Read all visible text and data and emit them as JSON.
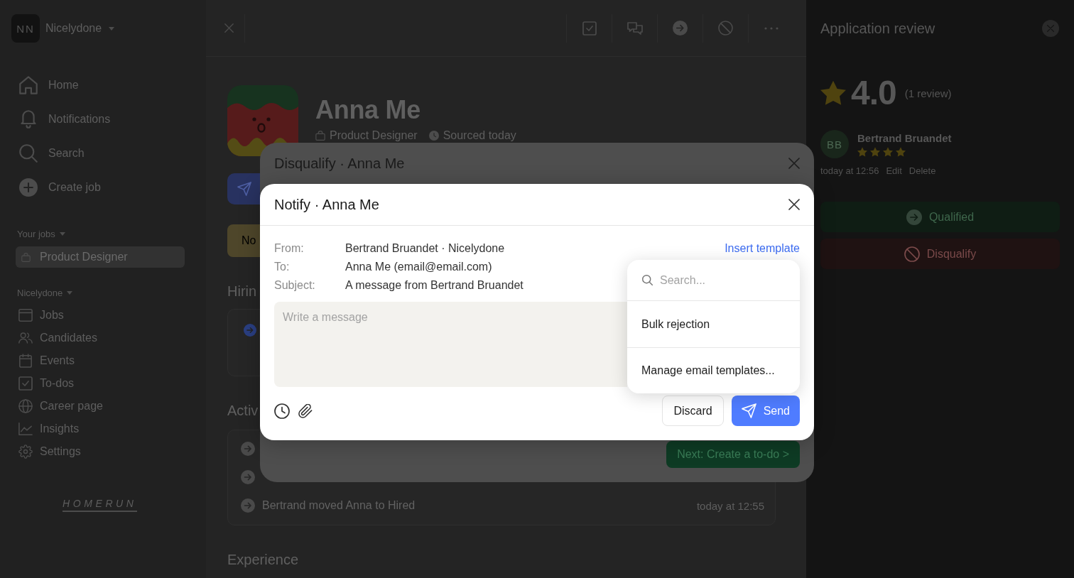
{
  "sidebar": {
    "workspace": {
      "initials": "NN",
      "name": "Nicelydone"
    },
    "nav": [
      {
        "label": "Home",
        "selected": false
      },
      {
        "label": "Notifications",
        "selected": false
      },
      {
        "label": "Search",
        "selected": false
      },
      {
        "label": "Create job",
        "selected": false
      }
    ],
    "your_jobs": {
      "heading": "Your jobs",
      "items": [
        {
          "label": "Product Designer",
          "selected": true
        }
      ]
    },
    "team": {
      "heading": "Nicelydone",
      "items": [
        {
          "label": "Jobs",
          "selected": false
        },
        {
          "label": "Candidates",
          "selected": false
        },
        {
          "label": "Events",
          "selected": false
        },
        {
          "label": "To-dos",
          "selected": false
        },
        {
          "label": "Career page",
          "selected": false
        },
        {
          "label": "Insights",
          "selected": false
        },
        {
          "label": "Settings",
          "selected": false
        }
      ]
    },
    "logo": "HOMERUN"
  },
  "profile": {
    "name": "Anna Me",
    "job": "Product Designer",
    "sourced": "Sourced today",
    "notice": "No",
    "hiring": {
      "heading": "Hirin"
    },
    "activity": {
      "heading": "Activ",
      "rows": [
        {
          "kind": "move"
        },
        {
          "kind": "move"
        },
        {
          "kind": "move",
          "text": "Bertrand moved Anna to Hired",
          "time": "today at 12:55"
        }
      ]
    },
    "experience": {
      "heading": "Experience"
    }
  },
  "review_panel": {
    "title": "Application review",
    "rating": "4.0",
    "review_count": "(1 review)",
    "reviews": [
      {
        "initials": "BB",
        "name": "Bertrand Bruandet",
        "stars": 4,
        "time": "today at 12:56",
        "actions": [
          "Edit",
          "Delete"
        ]
      }
    ],
    "buttons": [
      {
        "kind": "qualify",
        "label": "Qualified"
      },
      {
        "kind": "disqualify",
        "label": "Disqualify"
      }
    ]
  },
  "disqualify_dialog": {
    "title": "Disqualify · Anna Me",
    "next_button": "Next: Create a to-do >"
  },
  "notify_dialog": {
    "title": "Notify · Anna Me",
    "fields": [
      {
        "label": "From:",
        "value": "Bertrand Bruandet · Nicelydone"
      },
      {
        "label": "To:",
        "value": "Anna Me (email@email.com)"
      },
      {
        "label": "Subject:",
        "value": "A message from Bertrand Bruandet"
      }
    ],
    "insert_template": "Insert template",
    "message": {
      "placeholder": "Write a message"
    },
    "buttons": [
      {
        "kind": "secondary",
        "label": "Discard"
      },
      {
        "kind": "primary",
        "label": "Send"
      }
    ],
    "template_menu": {
      "search": {
        "placeholder": "Search..."
      },
      "items": [
        "Bulk rejection",
        "Manage email templates..."
      ]
    }
  }
}
